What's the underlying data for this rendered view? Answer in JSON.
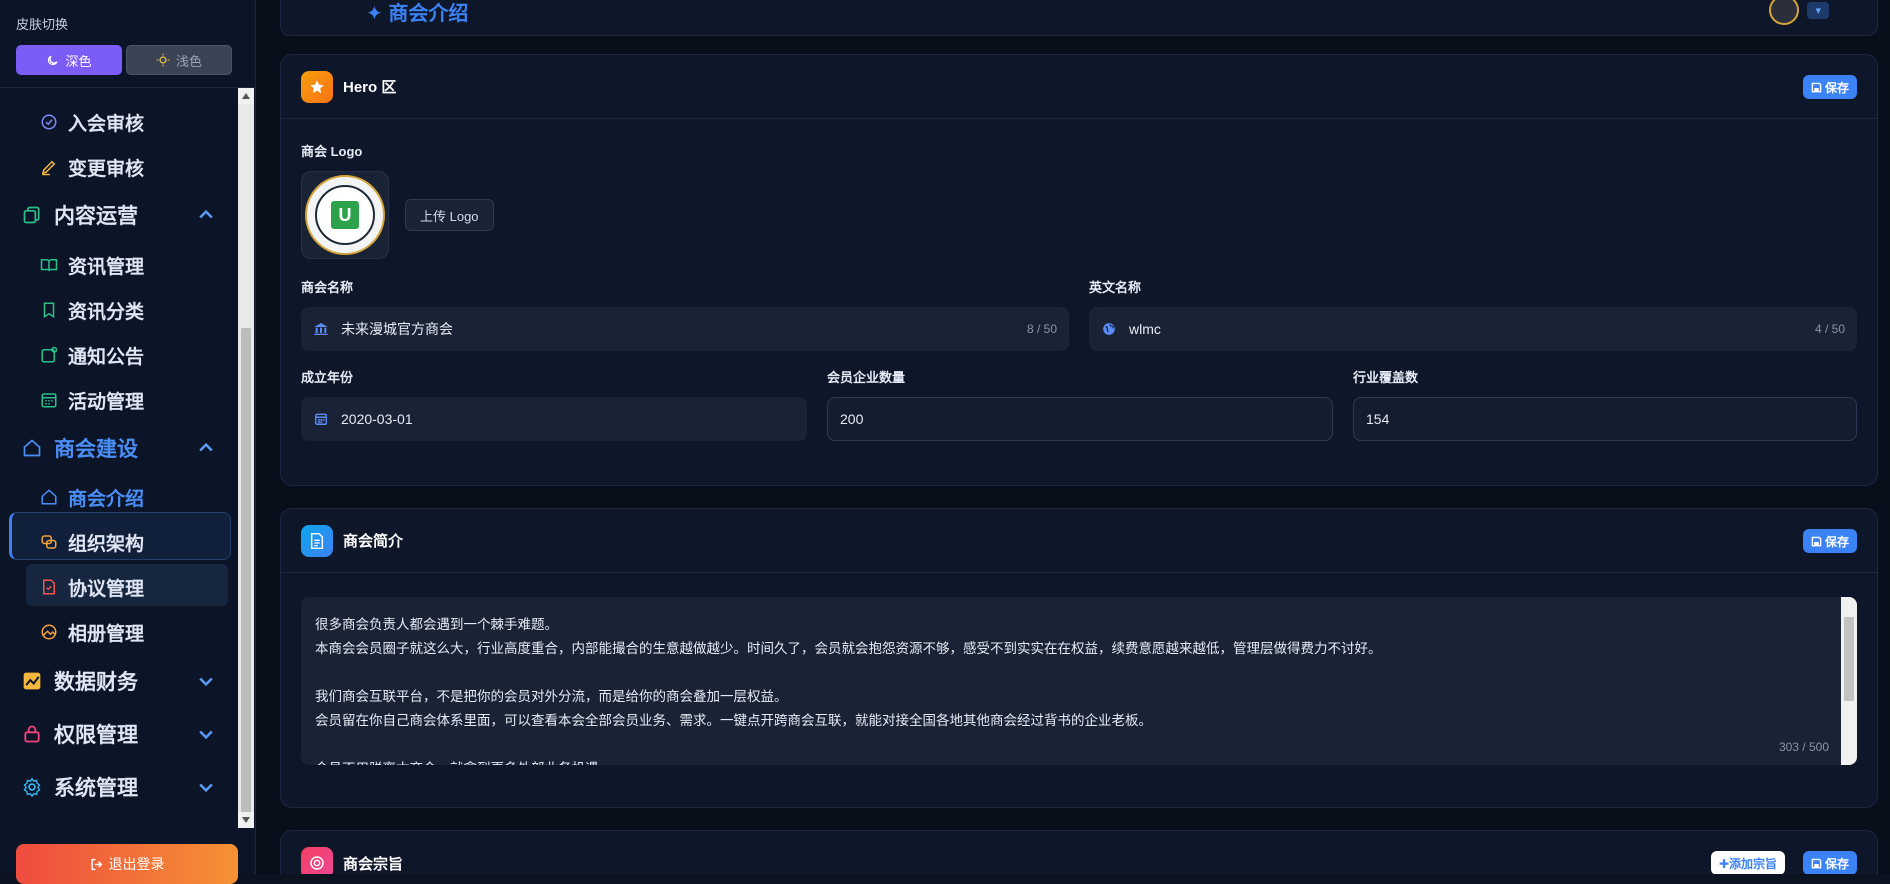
{
  "sidebar": {
    "skin_title": "皮肤切换",
    "skin_dark": "深色",
    "skin_light": "浅色",
    "items": [
      {
        "label": "入会审核",
        "icon": "check-circle-icon"
      },
      {
        "label": "变更审核",
        "icon": "pencil-icon"
      },
      {
        "label": "内容运营",
        "icon": "copy-icon"
      },
      {
        "label": "资讯管理",
        "icon": "book-open-icon"
      },
      {
        "label": "资讯分类",
        "icon": "bookmark-icon"
      },
      {
        "label": "通知公告",
        "icon": "notification-icon"
      },
      {
        "label": "活动管理",
        "icon": "calendar-icon"
      },
      {
        "label": "商会建设",
        "icon": "home-icon"
      },
      {
        "label": "商会介绍",
        "icon": "home-icon"
      },
      {
        "label": "组织架构",
        "icon": "link-icon"
      },
      {
        "label": "协议管理",
        "icon": "document-check-icon"
      },
      {
        "label": "相册管理",
        "icon": "image-icon"
      },
      {
        "label": "数据财务",
        "icon": "chart-icon"
      },
      {
        "label": "权限管理",
        "icon": "lock-icon"
      },
      {
        "label": "系统管理",
        "icon": "gear-icon"
      }
    ],
    "logout": "退出登录"
  },
  "header": {
    "breadcrumb": "商会介绍"
  },
  "hero": {
    "title": "Hero 区",
    "save": "保存",
    "logo_label": "商会 Logo",
    "logo_text": "U",
    "upload": "上传 Logo",
    "name_label": "商会名称",
    "name_value": "未来漫城官方商会",
    "name_count": "8 / 50",
    "en_label": "英文名称",
    "en_value": "wlmc",
    "en_count": "4 / 50",
    "year_label": "成立年份",
    "year_value": "2020-03-01",
    "members_label": "会员企业数量",
    "members_value": "200",
    "industry_label": "行业覆盖数",
    "industry_value": "154"
  },
  "intro": {
    "title": "商会简介",
    "save": "保存",
    "lines": [
      "很多商会负责人都会遇到一个棘手难题。",
      "本商会会员圈子就这么大，行业高度重合，内部能撮合的生意越做越少。时间久了，会员就会抱怨资源不够，感受不到实实在在权益，续费意愿越来越低，管理层做得费力不讨好。",
      "",
      "我们商会互联平台，不是把你的会员对外分流，而是给你的商会叠加一层权益。",
      "会员留在你自己商会体系里面，可以查看本会全部会员业务、需求。一键点开跨商会互联，就能对接全国各地其他商会经过背书的企业老板。",
      "",
      "会员不用脱离本商会，就拿到更多外部业务机遇"
    ],
    "count": "303 / 500"
  },
  "purpose": {
    "title": "商会宗旨",
    "add": "✚添加宗旨",
    "save": "保存"
  }
}
